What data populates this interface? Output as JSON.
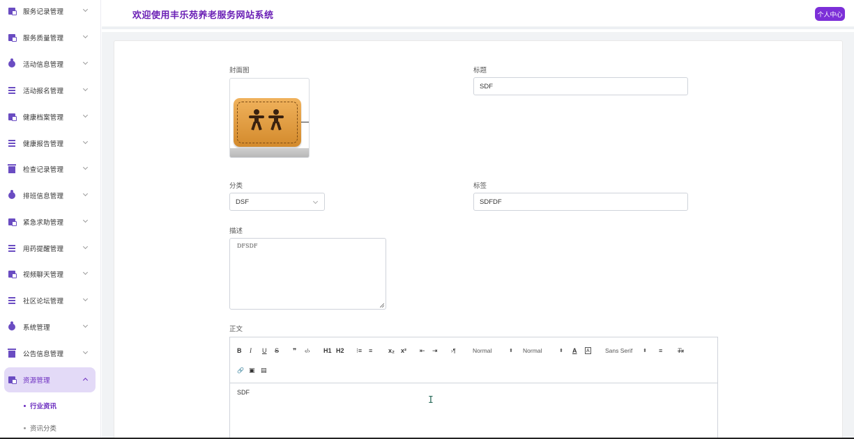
{
  "header": {
    "title": "欢迎使用丰乐苑养老服务网站系统",
    "profile_button": "个人中心"
  },
  "sidebar": {
    "items": [
      {
        "label": "服务记录管理",
        "icon": "document-icon"
      },
      {
        "label": "服务质量管理",
        "icon": "document-icon"
      },
      {
        "label": "活动信息管理",
        "icon": "drop-icon"
      },
      {
        "label": "活动报名管理",
        "icon": "list-icon"
      },
      {
        "label": "健康档案管理",
        "icon": "document-icon"
      },
      {
        "label": "健康报告管理",
        "icon": "list-icon"
      },
      {
        "label": "检查记录管理",
        "icon": "box-icon"
      },
      {
        "label": "排班信息管理",
        "icon": "drop-icon"
      },
      {
        "label": "紧急求助管理",
        "icon": "document-icon"
      },
      {
        "label": "用药提醒管理",
        "icon": "list-icon"
      },
      {
        "label": "视频聊天管理",
        "icon": "document-icon"
      },
      {
        "label": "社区论坛管理",
        "icon": "list-icon"
      },
      {
        "label": "系统管理",
        "icon": "drop-icon"
      },
      {
        "label": "公告信息管理",
        "icon": "box-icon"
      },
      {
        "label": "资源管理",
        "icon": "document-icon",
        "active": true
      }
    ],
    "subitems": [
      {
        "label": "行业资讯",
        "active": true
      },
      {
        "label": "资讯分类"
      }
    ]
  },
  "form": {
    "cover_label": "封面图",
    "title_label": "标题",
    "title_value": "SDF",
    "category_label": "分类",
    "category_value": "DSF",
    "tags_label": "标签",
    "tags_value": "SDFDF",
    "desc_label": "描述",
    "desc_value": "DFSDF",
    "content_label": "正文",
    "content_value": "SDF"
  },
  "toolbar": {
    "bold": "B",
    "italic": "I",
    "underline": "U",
    "strike": "S",
    "quote": "❞",
    "code": "‹/›",
    "h1": "H1",
    "h2": "H2",
    "ordered": "⁝≡",
    "bullet": "≡",
    "sub": "x₂",
    "sup": "x²",
    "outdent": "⇤",
    "indent": "⇥",
    "direction": "›¶",
    "size": "Normal",
    "header": "Normal",
    "color": "A",
    "background": "A",
    "font": "Sans Serif",
    "align": "≡",
    "clean": "Tx",
    "link": "🔗",
    "image": "▣",
    "video": "▤"
  },
  "colors": {
    "accent": "#7c2fd8",
    "title": "#6a1fb5",
    "active_bg": "#e3daf7"
  }
}
